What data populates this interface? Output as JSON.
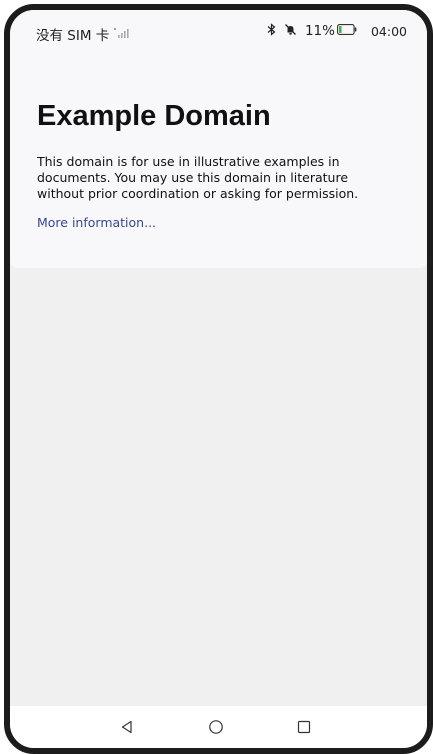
{
  "status_bar": {
    "carrier": "没有 SIM 卡",
    "battery_percent": "11%",
    "time": "04:00",
    "icons": [
      "signal-icon",
      "bluetooth-icon",
      "mute-icon",
      "battery-icon"
    ]
  },
  "page": {
    "title": "Example Domain",
    "body": "This domain is for use in illustrative examples in documents. You may use this domain in literature without prior coordination or asking for permission.",
    "link_label": "More information..."
  },
  "navigation": {
    "icons": [
      "back-icon",
      "home-icon",
      "recents-icon"
    ]
  },
  "colors": {
    "link": "#38488f",
    "frame": "#1c1c1c",
    "page_background": "#f0f0f1"
  }
}
